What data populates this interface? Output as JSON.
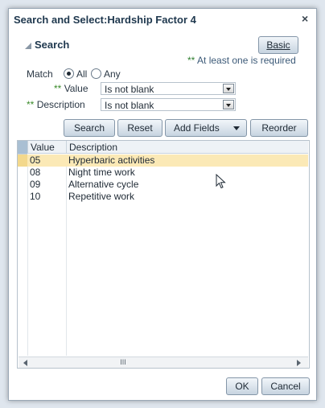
{
  "dialog": {
    "title": "Search and Select:Hardship Factor 4",
    "close_glyph": "×"
  },
  "search": {
    "header": "Search",
    "basic_button": "Basic",
    "required_note": "At least one is required",
    "required_marker": "**",
    "match_label": "Match",
    "match_options": [
      "All",
      "Any"
    ],
    "fields": [
      {
        "marker": "**",
        "label": "Value",
        "operator": "Is not blank"
      },
      {
        "marker": "**",
        "label": "Description",
        "operator": "Is not blank"
      }
    ],
    "buttons": {
      "search": "Search",
      "reset": "Reset",
      "add_fields": "Add Fields",
      "reorder": "Reorder"
    }
  },
  "results": {
    "columns": [
      "Value",
      "Description"
    ],
    "rows": [
      {
        "value": "05",
        "description": "Hyperbaric activities"
      },
      {
        "value": "08",
        "description": "Night time work"
      },
      {
        "value": "09",
        "description": "Alternative cycle"
      },
      {
        "value": "10",
        "description": "Repetitive work"
      }
    ],
    "scrollbar_thumb": "III"
  },
  "footer": {
    "ok": "OK",
    "cancel": "Cancel"
  }
}
